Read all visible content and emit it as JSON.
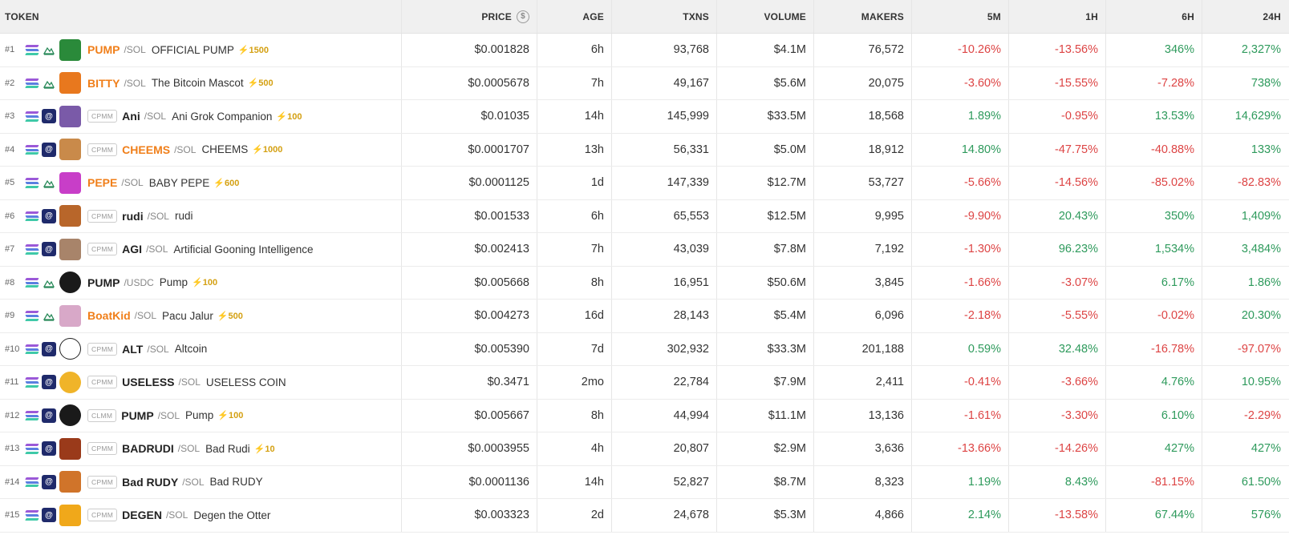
{
  "columns": {
    "token": "TOKEN",
    "price": "PRICE",
    "age": "AGE",
    "txns": "TXNS",
    "volume": "VOLUME",
    "makers": "MAKERS",
    "m5": "5M",
    "h1": "1H",
    "h6": "6H",
    "h24": "24H",
    "price_icon": "dollar-circle-icon"
  },
  "colors": {
    "positive": "#2e9a5c",
    "negative": "#dd4444",
    "boost": "#d4a012",
    "highlight_symbol": "#f07f1a"
  },
  "rows": [
    {
      "rank": "#1",
      "dex": "pump-icon",
      "badge": "",
      "symbol": "PUMP",
      "sym_orange": true,
      "quote": "/SOL",
      "name": "OFFICIAL PUMP",
      "boost": "⚡1500",
      "avatar_color": "#2a8a3a",
      "avatar_round": false,
      "price": "$0.001828",
      "age": "6h",
      "txns": "93,768",
      "volume": "$4.1M",
      "makers": "76,572",
      "m5": "-10.26%",
      "h1": "-13.56%",
      "h6": "346%",
      "h24": "2,327%"
    },
    {
      "rank": "#2",
      "dex": "pump-icon",
      "badge": "",
      "symbol": "BITTY",
      "sym_orange": true,
      "quote": "/SOL",
      "name": "The Bitcoin Mascot",
      "boost": "⚡500",
      "avatar_color": "#e8781e",
      "avatar_round": false,
      "price": "$0.0005678",
      "age": "7h",
      "txns": "49,167",
      "volume": "$5.6M",
      "makers": "20,075",
      "m5": "-3.60%",
      "h1": "-15.55%",
      "h6": "-7.28%",
      "h24": "738%"
    },
    {
      "rank": "#3",
      "dex": "raydium-icon",
      "badge": "CPMM",
      "symbol": "Ani",
      "sym_orange": false,
      "quote": "/SOL",
      "name": "Ani Grok Companion",
      "boost": "⚡100",
      "avatar_color": "#7a5aa8",
      "avatar_round": false,
      "price": "$0.01035",
      "age": "14h",
      "txns": "145,999",
      "volume": "$33.5M",
      "makers": "18,568",
      "m5": "1.89%",
      "h1": "-0.95%",
      "h6": "13.53%",
      "h24": "14,629%"
    },
    {
      "rank": "#4",
      "dex": "raydium-icon",
      "badge": "CPMM",
      "symbol": "CHEEMS",
      "sym_orange": true,
      "quote": "/SOL",
      "name": "CHEEMS",
      "boost": "⚡1000",
      "avatar_color": "#c98a4a",
      "avatar_round": false,
      "price": "$0.0001707",
      "age": "13h",
      "txns": "56,331",
      "volume": "$5.0M",
      "makers": "18,912",
      "m5": "14.80%",
      "h1": "-47.75%",
      "h6": "-40.88%",
      "h24": "133%"
    },
    {
      "rank": "#5",
      "dex": "pump-icon",
      "badge": "",
      "symbol": "PEPE",
      "sym_orange": true,
      "quote": "/SOL",
      "name": "BABY PEPE",
      "boost": "⚡600",
      "avatar_color": "#c83ec8",
      "avatar_round": false,
      "price": "$0.0001125",
      "age": "1d",
      "txns": "147,339",
      "volume": "$12.7M",
      "makers": "53,727",
      "m5": "-5.66%",
      "h1": "-14.56%",
      "h6": "-85.02%",
      "h24": "-82.83%"
    },
    {
      "rank": "#6",
      "dex": "raydium-icon",
      "badge": "CPMM",
      "symbol": "rudi",
      "sym_orange": false,
      "quote": "/SOL",
      "name": "rudi",
      "boost": "",
      "avatar_color": "#b8662a",
      "avatar_round": false,
      "price": "$0.001533",
      "age": "6h",
      "txns": "65,553",
      "volume": "$12.5M",
      "makers": "9,995",
      "m5": "-9.90%",
      "h1": "20.43%",
      "h6": "350%",
      "h24": "1,409%"
    },
    {
      "rank": "#7",
      "dex": "raydium-icon",
      "badge": "CPMM",
      "symbol": "AGI",
      "sym_orange": false,
      "quote": "/SOL",
      "name": "Artificial Gooning Intelligence",
      "boost": "",
      "avatar_color": "#a8846a",
      "avatar_round": false,
      "price": "$0.002413",
      "age": "7h",
      "txns": "43,039",
      "volume": "$7.8M",
      "makers": "7,192",
      "m5": "-1.30%",
      "h1": "96.23%",
      "h6": "1,534%",
      "h24": "3,484%"
    },
    {
      "rank": "#8",
      "dex": "pump-icon",
      "badge": "",
      "symbol": "PUMP",
      "sym_orange": false,
      "quote": "/USDC",
      "name": "Pump",
      "boost": "⚡100",
      "avatar_color": "#1a1a1a",
      "avatar_round": true,
      "price": "$0.005668",
      "age": "8h",
      "txns": "16,951",
      "volume": "$50.6M",
      "makers": "3,845",
      "m5": "-1.66%",
      "h1": "-3.07%",
      "h6": "6.17%",
      "h24": "1.86%"
    },
    {
      "rank": "#9",
      "dex": "pump-icon",
      "badge": "",
      "symbol": "BoatKid",
      "sym_orange": true,
      "quote": "/SOL",
      "name": "Pacu Jalur",
      "boost": "⚡500",
      "avatar_color": "#d8a8c8",
      "avatar_round": false,
      "price": "$0.004273",
      "age": "16d",
      "txns": "28,143",
      "volume": "$5.4M",
      "makers": "6,096",
      "m5": "-2.18%",
      "h1": "-5.55%",
      "h6": "-0.02%",
      "h24": "20.30%"
    },
    {
      "rank": "#10",
      "dex": "raydium-icon",
      "badge": "CPMM",
      "symbol": "ALT",
      "sym_orange": false,
      "quote": "/SOL",
      "name": "Altcoin",
      "boost": "",
      "avatar_color": "#ffffff",
      "avatar_round": true,
      "price": "$0.005390",
      "age": "7d",
      "txns": "302,932",
      "volume": "$33.3M",
      "makers": "201,188",
      "m5": "0.59%",
      "h1": "32.48%",
      "h6": "-16.78%",
      "h24": "-97.07%"
    },
    {
      "rank": "#11",
      "dex": "raydium-icon",
      "badge": "CPMM",
      "symbol": "USELESS",
      "sym_orange": false,
      "quote": "/SOL",
      "name": "USELESS COIN",
      "boost": "",
      "avatar_color": "#f0b429",
      "avatar_round": true,
      "price": "$0.3471",
      "age": "2mo",
      "txns": "22,784",
      "volume": "$7.9M",
      "makers": "2,411",
      "m5": "-0.41%",
      "h1": "-3.66%",
      "h6": "4.76%",
      "h24": "10.95%"
    },
    {
      "rank": "#12",
      "dex": "raydium-icon",
      "badge": "CLMM",
      "symbol": "PUMP",
      "sym_orange": false,
      "quote": "/SOL",
      "name": "Pump",
      "boost": "⚡100",
      "avatar_color": "#1a1a1a",
      "avatar_round": true,
      "price": "$0.005667",
      "age": "8h",
      "txns": "44,994",
      "volume": "$11.1M",
      "makers": "13,136",
      "m5": "-1.61%",
      "h1": "-3.30%",
      "h6": "6.10%",
      "h24": "-2.29%"
    },
    {
      "rank": "#13",
      "dex": "raydium-icon",
      "badge": "CPMM",
      "symbol": "BADRUDI",
      "sym_orange": false,
      "quote": "/SOL",
      "name": "Bad Rudi",
      "boost": "⚡10",
      "avatar_color": "#9a3a1a",
      "avatar_round": false,
      "price": "$0.0003955",
      "age": "4h",
      "txns": "20,807",
      "volume": "$2.9M",
      "makers": "3,636",
      "m5": "-13.66%",
      "h1": "-14.26%",
      "h6": "427%",
      "h24": "427%"
    },
    {
      "rank": "#14",
      "dex": "raydium-icon",
      "badge": "CPMM",
      "symbol": "Bad RUDY",
      "sym_orange": false,
      "quote": "/SOL",
      "name": "Bad RUDY",
      "boost": "",
      "avatar_color": "#d0742a",
      "avatar_round": false,
      "price": "$0.0001136",
      "age": "14h",
      "txns": "52,827",
      "volume": "$8.7M",
      "makers": "8,323",
      "m5": "1.19%",
      "h1": "8.43%",
      "h6": "-81.15%",
      "h24": "61.50%"
    },
    {
      "rank": "#15",
      "dex": "raydium-icon",
      "badge": "CPMM",
      "symbol": "DEGEN",
      "sym_orange": false,
      "quote": "/SOL",
      "name": "Degen the Otter",
      "boost": "",
      "avatar_color": "#f0a81a",
      "avatar_round": false,
      "price": "$0.003323",
      "age": "2d",
      "txns": "24,678",
      "volume": "$5.3M",
      "makers": "4,866",
      "m5": "2.14%",
      "h1": "-13.58%",
      "h6": "67.44%",
      "h24": "576%"
    }
  ]
}
